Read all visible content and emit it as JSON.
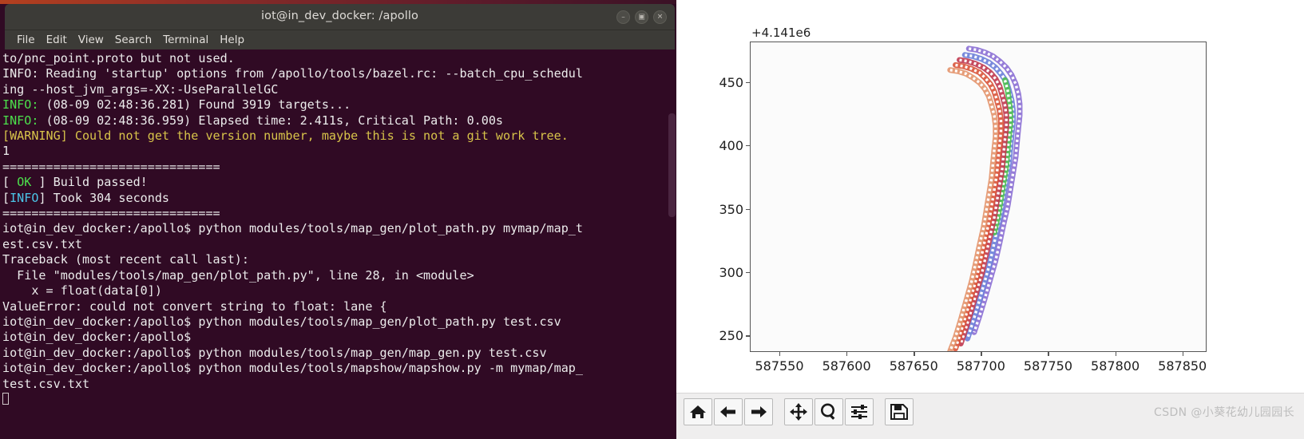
{
  "terminal": {
    "title": "iot@in_dev_docker: /apollo",
    "window_buttons": [
      {
        "name": "minimize",
        "glyph": "–"
      },
      {
        "name": "maximize",
        "glyph": "▣"
      },
      {
        "name": "close",
        "glyph": "✕"
      }
    ],
    "menu": [
      "File",
      "Edit",
      "View",
      "Search",
      "Terminal",
      "Help"
    ],
    "lines": [
      {
        "segments": [
          {
            "text": "to/pnc_point.proto but not used.",
            "color": "white"
          }
        ]
      },
      {
        "segments": [
          {
            "text": "INFO: Reading 'startup' options from /apollo/tools/bazel.rc: --batch_cpu_schedul",
            "color": "white"
          }
        ]
      },
      {
        "segments": [
          {
            "text": "ing --host_jvm_args=-XX:-UseParallelGC",
            "color": "white"
          }
        ]
      },
      {
        "segments": [
          {
            "text": "INFO:",
            "color": "green"
          },
          {
            "text": " (08-09 02:48:36.281) Found 3919 targets...",
            "color": "white"
          }
        ]
      },
      {
        "segments": [
          {
            "text": "INFO:",
            "color": "green"
          },
          {
            "text": " (08-09 02:48:36.959) Elapsed time: 2.411s, Critical Path: 0.00s",
            "color": "white"
          }
        ]
      },
      {
        "segments": [
          {
            "text": "[WARNING] Could not get the version number, maybe this is not a git work tree.",
            "color": "yellow"
          }
        ]
      },
      {
        "segments": [
          {
            "text": "1",
            "color": "white"
          }
        ]
      },
      {
        "segments": [
          {
            "text": "",
            "color": "white"
          }
        ]
      },
      {
        "segments": [
          {
            "text": "==============================",
            "color": "white"
          }
        ]
      },
      {
        "segments": [
          {
            "text": "[ ",
            "color": "white"
          },
          {
            "text": "OK",
            "color": "green"
          },
          {
            "text": " ] Build passed!",
            "color": "white"
          }
        ]
      },
      {
        "segments": [
          {
            "text": "[",
            "color": "white"
          },
          {
            "text": "INFO",
            "color": "cyan"
          },
          {
            "text": "] Took 304 seconds",
            "color": "white"
          }
        ]
      },
      {
        "segments": [
          {
            "text": "==============================",
            "color": "white"
          }
        ]
      },
      {
        "segments": [
          {
            "text": "iot@in_dev_docker:/apollo$ python modules/tools/map_gen/plot_path.py mymap/map_t",
            "color": "white"
          }
        ]
      },
      {
        "segments": [
          {
            "text": "est.csv.txt",
            "color": "white"
          }
        ]
      },
      {
        "segments": [
          {
            "text": "Traceback (most recent call last):",
            "color": "white"
          }
        ]
      },
      {
        "segments": [
          {
            "text": "  File \"modules/tools/map_gen/plot_path.py\", line 28, in <module>",
            "color": "white"
          }
        ]
      },
      {
        "segments": [
          {
            "text": "    x = float(data[0])",
            "color": "white"
          }
        ]
      },
      {
        "segments": [
          {
            "text": "ValueError: could not convert string to float: lane {",
            "color": "white"
          }
        ]
      },
      {
        "segments": [
          {
            "text": "iot@in_dev_docker:/apollo$ python modules/tools/map_gen/plot_path.py test.csv",
            "color": "white"
          }
        ]
      },
      {
        "segments": [
          {
            "text": "",
            "color": "white"
          }
        ]
      },
      {
        "segments": [
          {
            "text": "iot@in_dev_docker:/apollo$",
            "color": "white"
          }
        ]
      },
      {
        "segments": [
          {
            "text": "iot@in_dev_docker:/apollo$ python modules/tools/map_gen/map_gen.py test.csv",
            "color": "white"
          }
        ]
      },
      {
        "segments": [
          {
            "text": "iot@in_dev_docker:/apollo$ python modules/tools/mapshow/mapshow.py -m mymap/map_",
            "color": "white"
          }
        ]
      },
      {
        "segments": [
          {
            "text": "test.csv.txt",
            "color": "white"
          }
        ]
      }
    ]
  },
  "plot": {
    "toolbar_buttons": [
      {
        "name": "home-icon",
        "title": "Home"
      },
      {
        "name": "back-arrow-icon",
        "title": "Back"
      },
      {
        "name": "forward-arrow-icon",
        "title": "Forward"
      },
      {
        "name": "pan-move-icon",
        "title": "Pan"
      },
      {
        "name": "zoom-magnifier-icon",
        "title": "Zoom to rectangle"
      },
      {
        "name": "subplot-config-icon",
        "title": "Configure subplots"
      },
      {
        "name": "save-disk-icon",
        "title": "Save figure"
      }
    ],
    "watermark": "CSDN @小葵花幼儿园园长"
  },
  "chart_data": {
    "type": "line",
    "title": "",
    "xlabel": "",
    "ylabel": "",
    "y_offset_label": "+4.141e6",
    "xlim": [
      587528,
      587868
    ],
    "ylim": [
      237,
      482
    ],
    "xticks": [
      587550,
      587600,
      587650,
      587700,
      587750,
      587800,
      587850
    ],
    "yticks": [
      250,
      300,
      350,
      400,
      450
    ],
    "grid": false,
    "legend": false,
    "colors": {
      "lane_purple": "#8b6fd4",
      "lane_blue": "#6a7ed8",
      "lane_green": "#4fc04f",
      "lane_crimson": "#c0394f",
      "lane_red": "#d9543a",
      "lane_orange": "#e3936b",
      "marker_white": "#ffffff"
    },
    "series": [
      {
        "name": "lane-boundary-purple",
        "color": "#8b6fd4",
        "points": [
          [
            587691,
            477
          ],
          [
            587697,
            476
          ],
          [
            587703,
            474
          ],
          [
            587709,
            471
          ],
          [
            587714,
            467
          ],
          [
            587719,
            462
          ],
          [
            587723,
            456
          ],
          [
            587726,
            449
          ],
          [
            587728,
            441
          ],
          [
            587729,
            433
          ],
          [
            587729,
            424
          ],
          [
            587728,
            414
          ],
          [
            587727,
            403
          ],
          [
            587726,
            391
          ],
          [
            587724,
            378
          ],
          [
            587722,
            365
          ],
          [
            587720,
            352
          ],
          [
            587717,
            338
          ],
          [
            587714,
            323
          ],
          [
            587711,
            309
          ],
          [
            587707,
            294
          ],
          [
            587703,
            279
          ],
          [
            587699,
            265
          ],
          [
            587695,
            252
          ]
        ]
      },
      {
        "name": "lane-boundary-blue-green",
        "color": "#6a7ed8",
        "points": [
          [
            587688,
            472
          ],
          [
            587694,
            471
          ],
          [
            587700,
            469
          ],
          [
            587706,
            466
          ],
          [
            587711,
            462
          ],
          [
            587715,
            457
          ],
          [
            587719,
            451
          ],
          [
            587721,
            444
          ],
          [
            587723,
            436
          ],
          [
            587724,
            428
          ],
          [
            587724,
            419
          ],
          [
            587723,
            409
          ],
          [
            587722,
            398
          ],
          [
            587721,
            386
          ],
          [
            587719,
            373
          ],
          [
            587717,
            360
          ],
          [
            587715,
            347
          ],
          [
            587712,
            333
          ],
          [
            587709,
            318
          ],
          [
            587706,
            304
          ],
          [
            587702,
            289
          ],
          [
            587698,
            274
          ],
          [
            587694,
            260
          ],
          [
            587690,
            247
          ]
        ]
      },
      {
        "name": "lane-boundary-green",
        "color": "#4fc04f",
        "points": [
          [
            587718,
            452
          ],
          [
            587720,
            444
          ],
          [
            587721,
            436
          ],
          [
            587722,
            427
          ],
          [
            587722,
            418
          ],
          [
            587721,
            407
          ],
          [
            587720,
            396
          ],
          [
            587719,
            384
          ],
          [
            587717,
            371
          ],
          [
            587715,
            358
          ],
          [
            587713,
            345
          ],
          [
            587710,
            331
          ]
        ]
      },
      {
        "name": "lane-boundary-crimson",
        "color": "#c0394f",
        "points": [
          [
            587684,
            468
          ],
          [
            587690,
            467
          ],
          [
            587696,
            465
          ],
          [
            587702,
            462
          ],
          [
            587707,
            458
          ],
          [
            587711,
            453
          ],
          [
            587714,
            447
          ],
          [
            587716,
            440
          ],
          [
            587718,
            432
          ],
          [
            587719,
            424
          ],
          [
            587719,
            415
          ],
          [
            587718,
            405
          ],
          [
            587717,
            394
          ],
          [
            587716,
            382
          ],
          [
            587714,
            369
          ],
          [
            587712,
            356
          ],
          [
            587710,
            343
          ],
          [
            587707,
            329
          ],
          [
            587704,
            314
          ],
          [
            587701,
            300
          ],
          [
            587697,
            285
          ],
          [
            587693,
            270
          ],
          [
            587689,
            256
          ],
          [
            587685,
            243
          ]
        ]
      },
      {
        "name": "lane-boundary-red",
        "color": "#d9543a",
        "points": [
          [
            587681,
            464
          ],
          [
            587687,
            463
          ],
          [
            587693,
            461
          ],
          [
            587699,
            458
          ],
          [
            587703,
            454
          ],
          [
            587707,
            449
          ],
          [
            587710,
            443
          ],
          [
            587712,
            436
          ],
          [
            587714,
            428
          ],
          [
            587715,
            420
          ],
          [
            587715,
            411
          ],
          [
            587714,
            401
          ],
          [
            587713,
            390
          ],
          [
            587712,
            378
          ],
          [
            587710,
            365
          ],
          [
            587708,
            352
          ],
          [
            587706,
            339
          ],
          [
            587703,
            325
          ],
          [
            587700,
            310
          ],
          [
            587697,
            296
          ],
          [
            587693,
            281
          ],
          [
            587689,
            266
          ],
          [
            587685,
            252
          ],
          [
            587681,
            239
          ]
        ]
      },
      {
        "name": "lane-boundary-orange",
        "color": "#e3936b",
        "points": [
          [
            587677,
            460
          ],
          [
            587683,
            459
          ],
          [
            587689,
            457
          ],
          [
            587694,
            454
          ],
          [
            587699,
            450
          ],
          [
            587703,
            445
          ],
          [
            587706,
            439
          ],
          [
            587708,
            432
          ],
          [
            587710,
            424
          ],
          [
            587711,
            416
          ],
          [
            587711,
            407
          ],
          [
            587710,
            397
          ],
          [
            587709,
            386
          ],
          [
            587708,
            374
          ],
          [
            587706,
            361
          ],
          [
            587704,
            348
          ],
          [
            587702,
            335
          ],
          [
            587699,
            321
          ],
          [
            587696,
            306
          ],
          [
            587693,
            292
          ],
          [
            587689,
            277
          ],
          [
            587685,
            262
          ],
          [
            587681,
            248
          ],
          [
            587677,
            237
          ]
        ]
      }
    ]
  }
}
